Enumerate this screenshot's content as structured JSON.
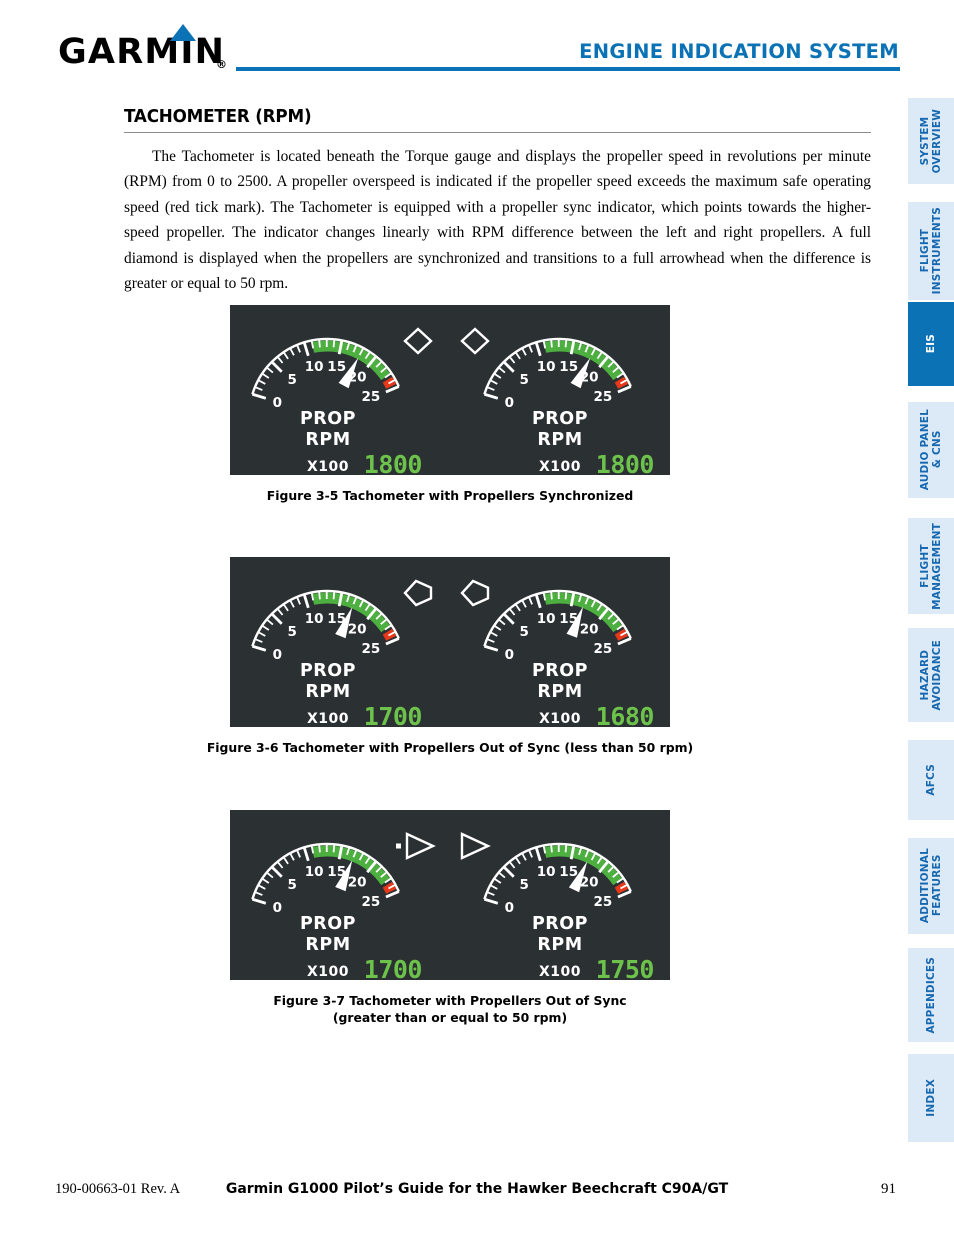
{
  "header": {
    "logo_text": "GARMIN",
    "logo_registered": "®",
    "title": "ENGINE INDICATION SYSTEM",
    "accent_color": "#0a72b5"
  },
  "sidebar": {
    "active_index": 2,
    "items": [
      {
        "label": "SYSTEM\nOVERVIEW",
        "active": false
      },
      {
        "label": "FLIGHT\nINSTRUMENTS",
        "active": false
      },
      {
        "label": "EIS",
        "active": true
      },
      {
        "label": "AUDIO PANEL\n& CNS",
        "active": false
      },
      {
        "label": "FLIGHT\nMANAGEMENT",
        "active": false
      },
      {
        "label": "HAZARD\nAVOIDANCE",
        "active": false
      },
      {
        "label": "AFCS",
        "active": false
      },
      {
        "label": "ADDITIONAL\nFEATURES",
        "active": false
      },
      {
        "label": "APPENDICES",
        "active": false
      },
      {
        "label": "INDEX",
        "active": false
      }
    ]
  },
  "main": {
    "section_title": "TACHOMETER (RPM)",
    "body": "The Tachometer is located beneath the Torque gauge and displays the propeller speed in revolutions per minute (RPM) from 0 to 2500.  A propeller overspeed is indicated if the propeller speed exceeds the maximum safe operating speed (red tick mark).  The Tachometer is equipped with a propeller sync indicator, which points towards the higher-speed propeller.  The indicator changes linearly with RPM difference between the left and right propellers.  A full diamond is displayed when the propellers are synchronized and transitions to a full arrowhead when the difference is greater or equal to 50 rpm."
  },
  "figures": [
    {
      "id": "figure-3-5",
      "caption": "Figure 3-5  Tachometer with Propellers Synchronized",
      "sync_state": "diamond",
      "gauges": [
        {
          "side": "left",
          "label_line1": "PROP",
          "label_line2": "RPM",
          "multiplier": "X100",
          "readout": "1800",
          "value": 1800
        },
        {
          "side": "right",
          "label_line1": "PROP",
          "label_line2": "RPM",
          "multiplier": "X100",
          "readout": "1800",
          "value": 1800
        }
      ]
    },
    {
      "id": "figure-3-6",
      "caption": "Figure 3-6  Tachometer with Propellers Out of Sync (less than 50 rpm)",
      "sync_state": "partial",
      "gauges": [
        {
          "side": "left",
          "label_line1": "PROP",
          "label_line2": "RPM",
          "multiplier": "X100",
          "readout": "1700",
          "value": 1700
        },
        {
          "side": "right",
          "label_line1": "PROP",
          "label_line2": "RPM",
          "multiplier": "X100",
          "readout": "1680",
          "value": 1680
        }
      ]
    },
    {
      "id": "figure-3-7",
      "caption": "Figure 3-7  Tachometer with Propellers Out of Sync",
      "caption_line2": "(greater than or equal to 50 rpm)",
      "sync_state": "arrow",
      "gauges": [
        {
          "side": "left",
          "label_line1": "PROP",
          "label_line2": "RPM",
          "multiplier": "X100",
          "readout": "1700",
          "value": 1700
        },
        {
          "side": "right",
          "label_line1": "PROP",
          "label_line2": "RPM",
          "multiplier": "X100",
          "readout": "1750",
          "value": 1750
        }
      ]
    }
  ],
  "gauge_scale": {
    "tick_labels": [
      "0",
      "5",
      "10",
      "15",
      "20",
      "25"
    ],
    "min": 0,
    "max": 25,
    "green_band": [
      11,
      23
    ],
    "red_mark": 24,
    "green_color": "#4caf3f",
    "red_color": "#e8381a",
    "readout_color": "#6cc24a",
    "panel_background": "#2b3033"
  },
  "footer": {
    "left": "190-00663-01 Rev. A",
    "center": "Garmin G1000 Pilot’s Guide for the Hawker Beechcraft C90A/GT",
    "right": "91"
  }
}
